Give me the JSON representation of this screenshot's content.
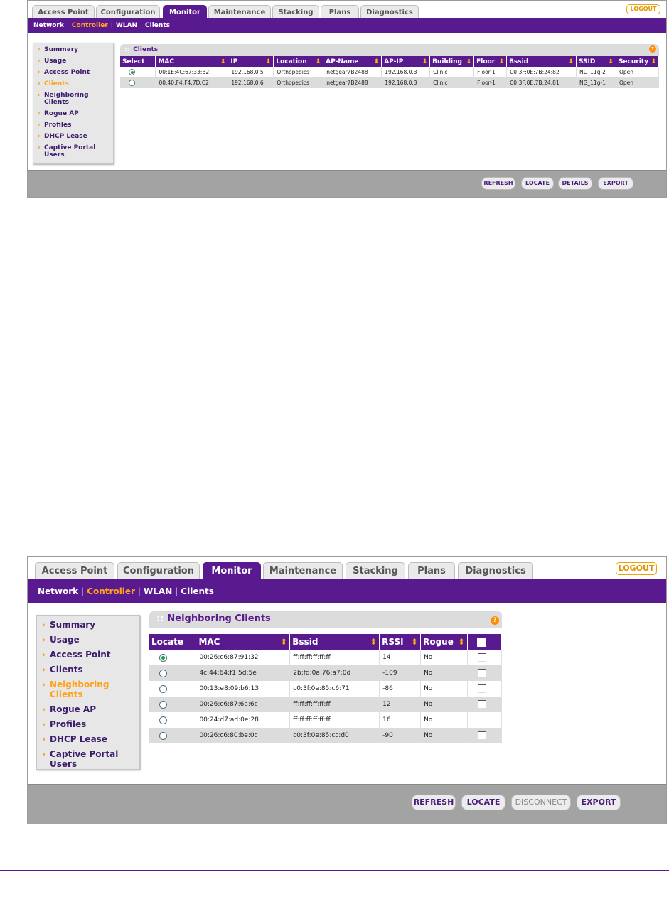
{
  "clients_screen": {
    "tabs": [
      "Access Point",
      "Configuration",
      "Monitor",
      "Maintenance",
      "Stacking",
      "Plans",
      "Diagnostics"
    ],
    "active_tab": "Monitor",
    "logout_label": "LOGOUT",
    "subnav": [
      "Network",
      "Controller",
      "WLAN",
      "Clients"
    ],
    "sidebar": [
      "Summary",
      "Usage",
      "Access Point",
      "Clients",
      "Neighboring Clients",
      "Rogue AP",
      "Profiles",
      "DHCP Lease",
      "Captive Portal Users"
    ],
    "current_sidebar_item": "Clients",
    "panel_title": "Clients",
    "help_icon": "help-circle-icon",
    "columns": [
      "Select",
      "MAC",
      "IP",
      "Location",
      "AP-Name",
      "AP-IP",
      "Building",
      "Floor",
      "Bssid",
      "SSID",
      "Security"
    ],
    "rows": [
      {
        "selected": true,
        "mac": "00:1E:4C:67:33:B2",
        "ip": "192.168.0.5",
        "location": "Orthopedics",
        "ap_name": "netgear7B2488",
        "ap_ip": "192.168.0.3",
        "building": "Clinic",
        "floor": "Floor-1",
        "bssid": "C0:3F:0E:7B:24:82",
        "ssid": "NG_11g-2",
        "security": "Open"
      },
      {
        "selected": false,
        "mac": "00:40:F4:F4:7D:C2",
        "ip": "192.168.0.6",
        "location": "Orthopedics",
        "ap_name": "netgear7B2488",
        "ap_ip": "192.168.0.3",
        "building": "Clinic",
        "floor": "Floor-1",
        "bssid": "C0:3F:0E:7B:24:81",
        "ssid": "NG_11g-1",
        "security": "Open"
      }
    ],
    "buttons": [
      "REFRESH",
      "LOCATE",
      "DETAILS",
      "EXPORT"
    ]
  },
  "neighboring_screen": {
    "tabs": [
      "Access Point",
      "Configuration",
      "Monitor",
      "Maintenance",
      "Stacking",
      "Plans",
      "Diagnostics"
    ],
    "active_tab": "Monitor",
    "logout_label": "LOGOUT",
    "subnav": [
      "Network",
      "Controller",
      "WLAN",
      "Clients"
    ],
    "sidebar": [
      "Summary",
      "Usage",
      "Access Point",
      "Clients",
      "Neighboring Clients",
      "Rogue AP",
      "Profiles",
      "DHCP Lease",
      "Captive Portal Users"
    ],
    "current_sidebar_item": "Neighboring Clients",
    "panel_title": "Neighboring Clients",
    "help_icon": "help-circle-icon",
    "columns": [
      "Locate",
      "MAC",
      "Bssid",
      "RSSI",
      "Rogue"
    ],
    "rows": [
      {
        "selected": true,
        "mac": "00:26:c6:87:91:32",
        "bssid": "ff:ff:ff:ff:ff:ff",
        "rssi": "14",
        "rogue": "No"
      },
      {
        "selected": false,
        "mac": "4c:44:64:f1:5d:5e",
        "bssid": "2b:fd:0a:76:a7:0d",
        "rssi": "-109",
        "rogue": "No"
      },
      {
        "selected": false,
        "mac": "00:13:e8:09:b6:13",
        "bssid": "c0:3f:0e:85:c6:71",
        "rssi": "-86",
        "rogue": "No"
      },
      {
        "selected": false,
        "mac": "00:26:c6:87:6a:6c",
        "bssid": "ff:ff:ff:ff:ff:ff",
        "rssi": "12",
        "rogue": "No"
      },
      {
        "selected": false,
        "mac": "00:24:d7:ad:0e:28",
        "bssid": "ff:ff:ff:ff:ff:ff",
        "rssi": "16",
        "rogue": "No"
      },
      {
        "selected": false,
        "mac": "00:26:c6:80:be:0c",
        "bssid": "c0:3f:0e:85:cc:d0",
        "rssi": "-90",
        "rogue": "No"
      }
    ],
    "buttons": [
      "REFRESH",
      "LOCATE",
      "DISCONNECT",
      "EXPORT"
    ],
    "disabled_buttons": [
      "DISCONNECT"
    ]
  },
  "colors": {
    "brand_purple": "#5a1a8f",
    "accent_orange": "#ffa31a",
    "radio_selected": "#1f9a4c"
  }
}
